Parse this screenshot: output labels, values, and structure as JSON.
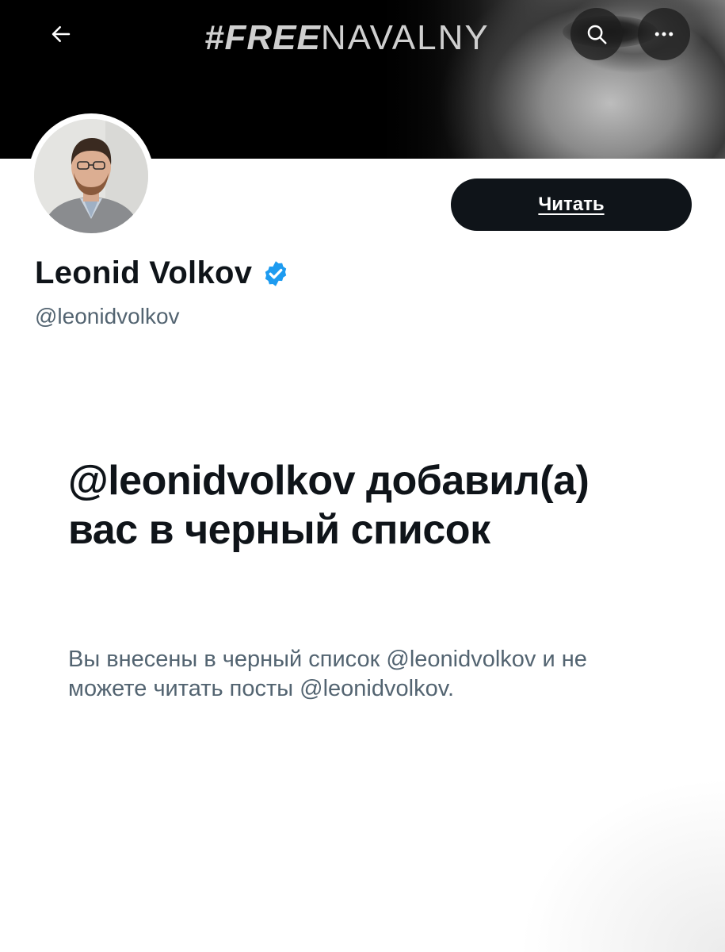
{
  "header": {
    "banner_title_bold": "#FREE",
    "banner_title_light": "NAVALNY",
    "back_icon": "arrow-left-icon",
    "search_icon": "search-icon",
    "more_icon": "more-horizontal-icon"
  },
  "profile": {
    "follow_label": "Читать",
    "display_name": "Leonid Volkov",
    "verified_icon": "verified-badge-icon",
    "verified_color": "#1d9bf0",
    "handle": "@leonidvolkov"
  },
  "blocked": {
    "title": "@leonidvolkov добавил(а) вас в черный список",
    "message": "Вы внесены в черный список @leonidvolkov и не можете читать посты @leonidvolkov."
  },
  "colors": {
    "text_primary": "#0f1419",
    "text_secondary": "#536471",
    "button_bg": "#0f1419"
  }
}
